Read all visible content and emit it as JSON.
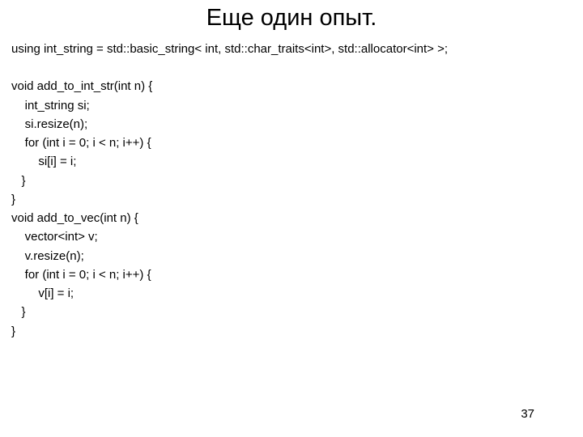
{
  "title": "Еще один опыт.",
  "code": {
    "l0": "using int_string = std::basic_string< int, std::char_traits<int>, std::allocator<int> >;",
    "l1": "void add_to_int_str(int n) {",
    "l2": "    int_string si;",
    "l3": "    si.resize(n);",
    "l4": "    for (int i = 0; i < n; i++) {",
    "l5": "        si[i] = i;",
    "l6": "   }",
    "l7": "}",
    "l8": "void add_to_vec(int n) {",
    "l9": "    vector<int> v;",
    "l10": "    v.resize(n);",
    "l11": "    for (int i = 0; i < n; i++) {",
    "l12": "        v[i] = i;",
    "l13": "   }",
    "l14": "}"
  },
  "page_number": "37"
}
